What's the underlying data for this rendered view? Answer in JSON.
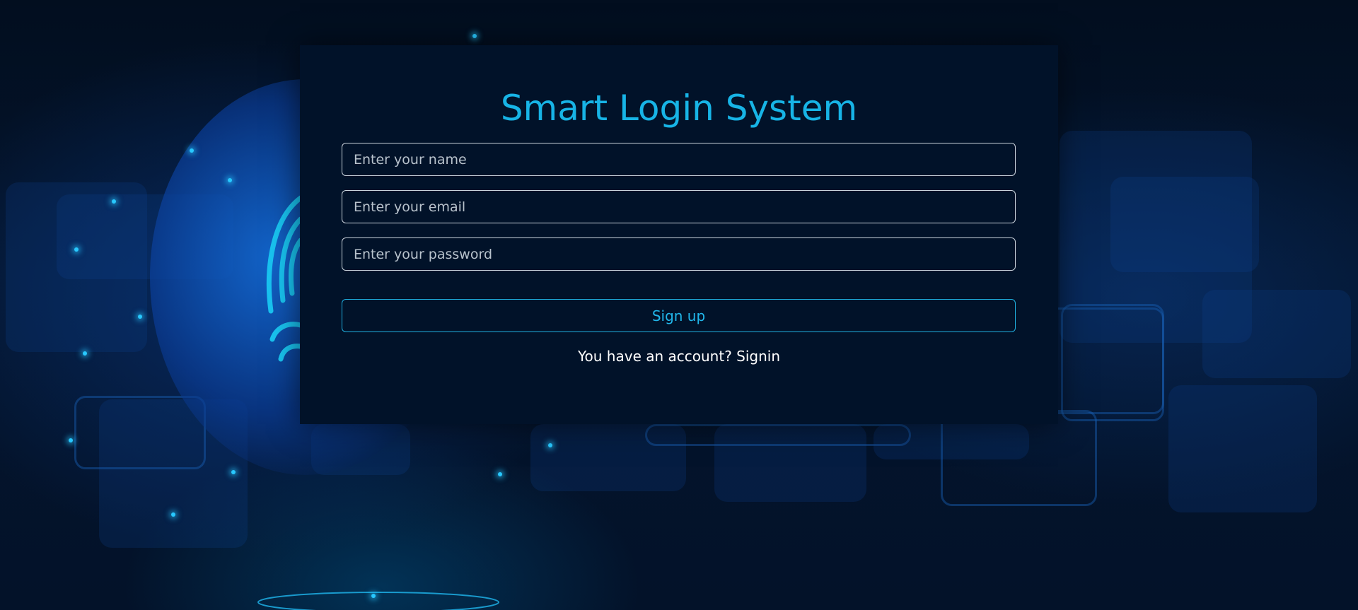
{
  "form": {
    "title": "Smart Login System",
    "name_placeholder": "Enter your name",
    "email_placeholder": "Enter your email",
    "password_placeholder": "Enter your password",
    "submit_label": "Sign up",
    "account_prompt": "You have an account?",
    "signin_link": "Signin"
  },
  "colors": {
    "background": "#031126",
    "card": "#011229",
    "accent": "#17b4e6",
    "field_border": "#c9d3dc"
  },
  "background": {
    "illustration": "globe-fingerprint-icon"
  }
}
